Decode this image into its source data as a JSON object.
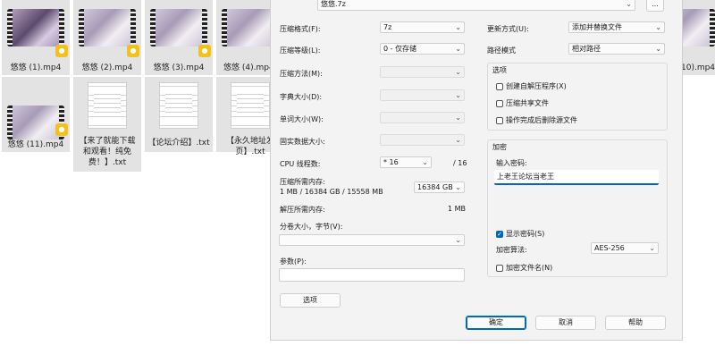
{
  "files": [
    {
      "name": "悠悠 (1).mp4",
      "type": "video",
      "badge": "Potplayer"
    },
    {
      "name": "悠悠 (2).mp4",
      "type": "video",
      "badge": "Potplayer"
    },
    {
      "name": "悠悠 (3).mp4",
      "type": "video",
      "badge": "Potplayer"
    },
    {
      "name": "悠悠 (4).mp4",
      "type": "video",
      "badge": "Potplayer"
    },
    {
      "name": "10).mp4",
      "type": "video",
      "badge": "Potplayer"
    },
    {
      "name": "悠悠 (11).mp4",
      "type": "video",
      "badge": "Potplayer"
    },
    {
      "name": "【来了就能下载和观看！纯免费！】.txt",
      "type": "txt"
    },
    {
      "name": "【论坛介绍】.txt",
      "type": "txt"
    },
    {
      "name": "【永久地址发页】.txt",
      "type": "txt"
    }
  ],
  "dialog": {
    "archive_name": "悠悠.7z",
    "browse_label": "...",
    "format_label": "压缩格式(F):",
    "format_value": "7z",
    "level_label": "压缩等级(L):",
    "level_value": "0 - 仅存储",
    "method_label": "压缩方法(M):",
    "dict_label": "字典大小(D):",
    "word_label": "单词大小(W):",
    "solid_label": "固实数据大小:",
    "threads_label": "CPU 线程数:",
    "threads_value": "* 16",
    "threads_max": "/ 16",
    "mem_comp_label": "压缩所需内存:",
    "mem_comp_detail": "1 MB / 16384 GB / 15558 MB",
    "mem_comp_value": "16384 GB",
    "mem_decomp_label": "解压所需内存:",
    "mem_decomp_value": "1 MB",
    "volume_label": "分卷大小，字节(V):",
    "params_label": "参数(P):",
    "options_button": "选项",
    "update_label": "更新方式(U):",
    "update_value": "添加并替换文件",
    "path_label": "路径模式",
    "path_value": "相对路径",
    "options_group": "选项",
    "opt_sfx": "创建自解压程序(X)",
    "opt_shared": "压缩共享文件",
    "opt_delete": "操作完成后删除源文件",
    "encrypt_group": "加密",
    "pwd_label": "输入密码:",
    "pwd_value": "上老王论坛当老王",
    "show_pwd": "显示密码(S)",
    "enc_method_label": "加密算法:",
    "enc_method_value": "AES-256",
    "enc_names": "加密文件名(N)",
    "ok": "确定",
    "cancel": "取消",
    "help": "帮助"
  }
}
